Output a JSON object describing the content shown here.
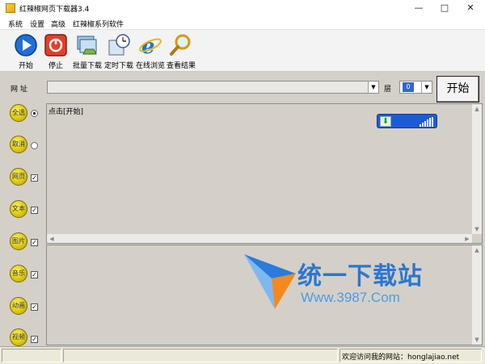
{
  "window": {
    "title": "红辣椒网页下载器3.4"
  },
  "menu": [
    "系统",
    "设置",
    "高级",
    "红辣椒系列软件"
  ],
  "toolbar": [
    {
      "label": "开始",
      "icon": "play-icon"
    },
    {
      "label": "停止",
      "icon": "stop-icon"
    },
    {
      "label": "批量下载",
      "icon": "batch-download-icon"
    },
    {
      "label": "定时下载",
      "icon": "timer-download-icon"
    },
    {
      "label": "在线浏览",
      "icon": "ie-browser-icon"
    },
    {
      "label": "查看结果",
      "icon": "search-results-icon"
    }
  ],
  "form": {
    "url_label": "网 址",
    "url_value": "",
    "layer_label": "层",
    "layer_value": "0",
    "start_button": "开始"
  },
  "options": [
    {
      "label": "全选",
      "control": "radio",
      "checked": true
    },
    {
      "label": "取消",
      "control": "radio",
      "checked": false
    },
    {
      "label": "网页",
      "control": "checkbox",
      "checked": true
    },
    {
      "label": "文本",
      "control": "checkbox",
      "checked": true
    },
    {
      "label": "图片",
      "control": "checkbox",
      "checked": true
    },
    {
      "label": "音乐",
      "control": "checkbox",
      "checked": true
    },
    {
      "label": "动画",
      "control": "checkbox",
      "checked": true
    },
    {
      "label": "视频",
      "control": "checkbox",
      "checked": true
    }
  ],
  "log": {
    "text": "点击[开始]"
  },
  "watermark": {
    "title": "统一下载站",
    "url": "Www.3987.Com"
  },
  "status": {
    "message": "欢迎访问我的网站：honglajiao.net"
  },
  "colors": {
    "app_bg": "#d4d0c8",
    "accent_blue": "#2b76d1",
    "option_yellow": "#e4d11d"
  }
}
